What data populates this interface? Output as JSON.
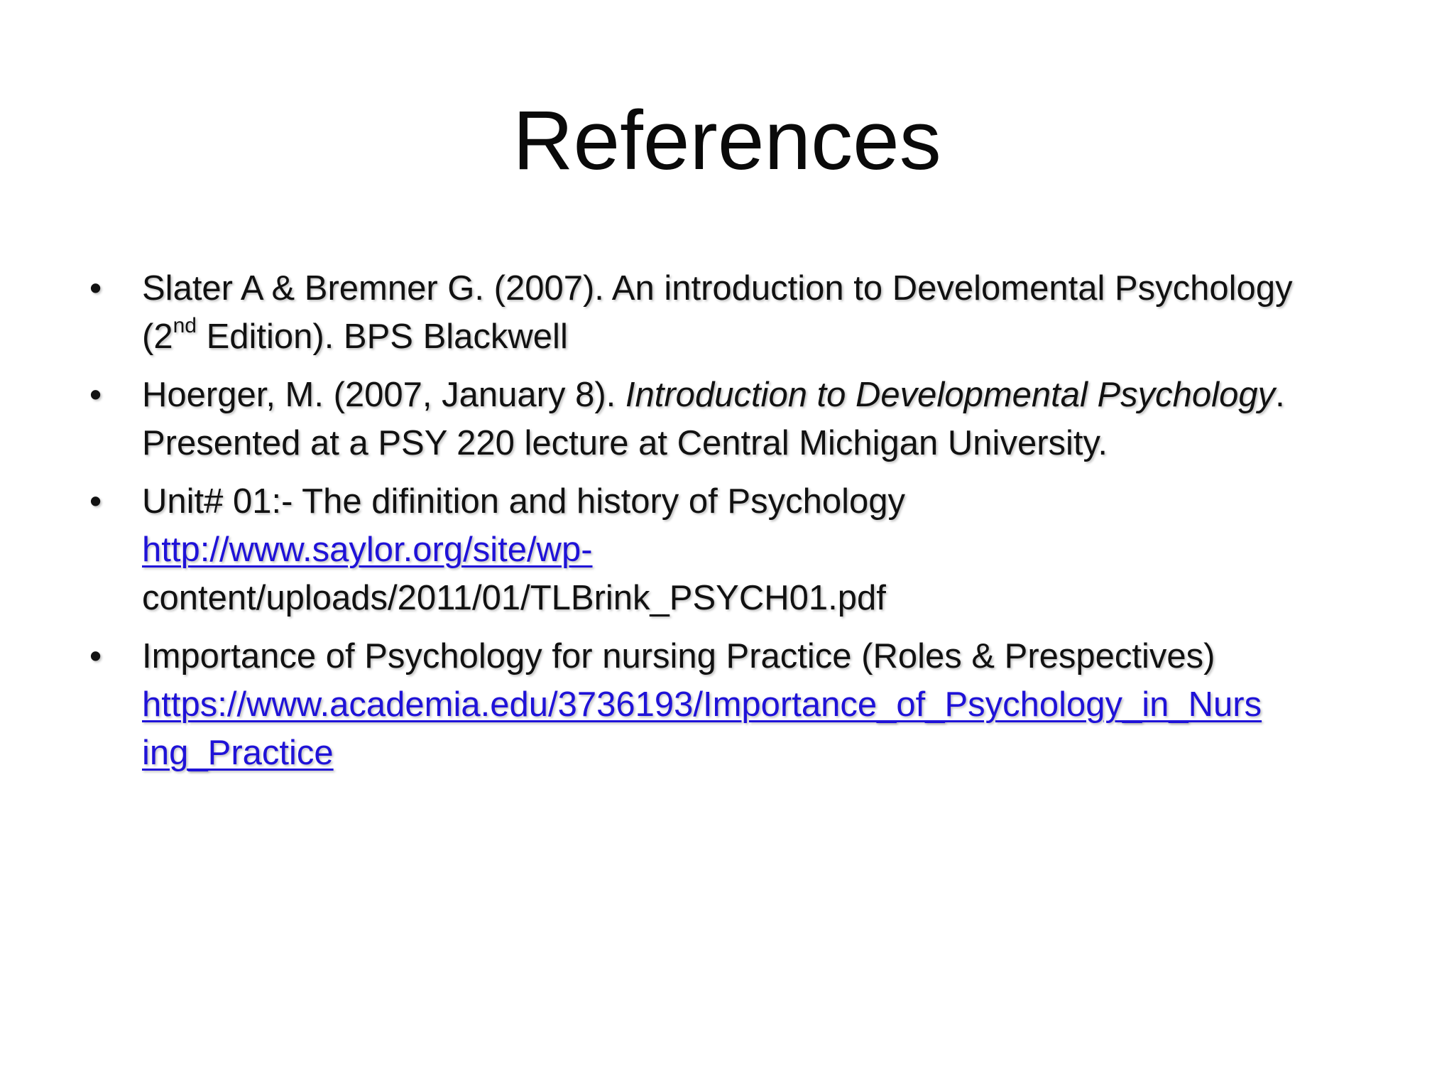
{
  "slide": {
    "title": "References",
    "bullet_char": "•",
    "references": [
      {
        "line1": "Slater A & Bremner G. (2007). An introduction to Develomental Psychology",
        "line2_pre": "(2",
        "line2_sup": "nd",
        "line2_post": " Edition). BPS Blackwell"
      },
      {
        "line1_pre": "Hoerger, M. (2007, January 8). ",
        "line1_italic": "Introduction to Developmental Psychology",
        "line1_post": ".",
        "line2": "Presented at a PSY 220 lecture at Central Michigan University."
      },
      {
        "line1": "Unit# 01:- The difinition and history of Psychology",
        "link": "http://www.saylor.org/site/wp-",
        "line3": "content/uploads/2011/01/TLBrink_PSYCH01.pdf"
      },
      {
        "line1": "Importance of Psychology for nursing Practice (Roles & Prespectives)",
        "link_part1": "https://www.academia.edu/3736193/Importance_of_Psychology_in_Nurs",
        "link_part2": "ing_Practice"
      }
    ],
    "colors": {
      "text": "#111111",
      "link": "#1f12d8",
      "background": "#ffffff"
    }
  }
}
